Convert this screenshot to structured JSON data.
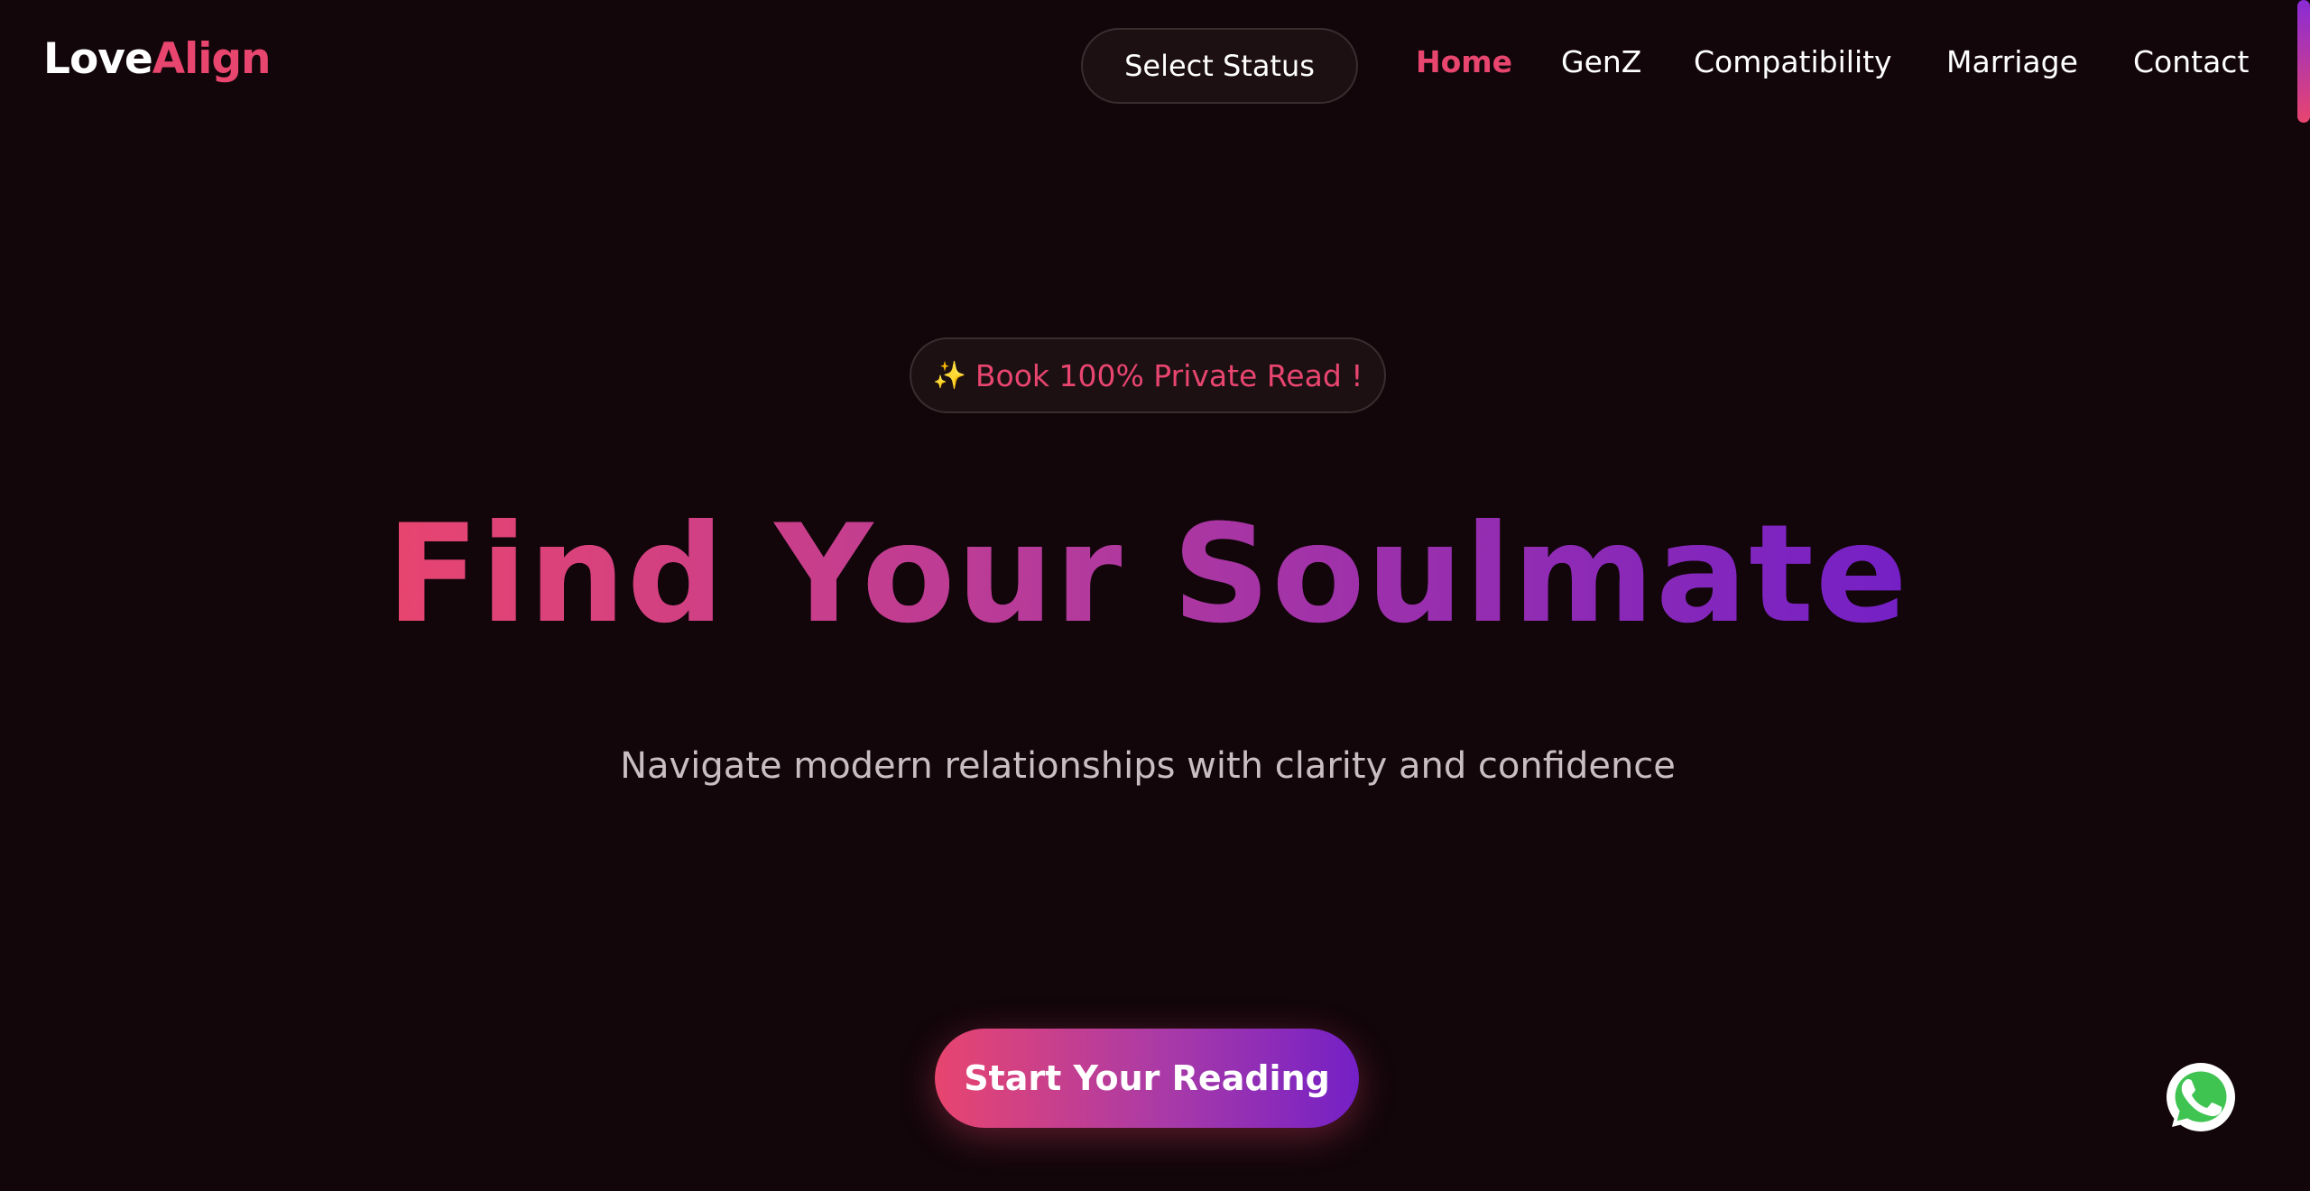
{
  "brand": {
    "part1": "Love",
    "part2": "Align"
  },
  "nav": {
    "status_select": "Select Status",
    "links": [
      {
        "label": "Home",
        "active": true
      },
      {
        "label": "GenZ",
        "active": false
      },
      {
        "label": "Compatibility",
        "active": false
      },
      {
        "label": "Marriage",
        "active": false
      },
      {
        "label": "Contact",
        "active": false
      }
    ]
  },
  "hero": {
    "badge_icon": "sparkles-icon",
    "badge_text": "Book 100% Private Read !",
    "title": "Find Your Soulmate",
    "subtitle": "Navigate modern relationships with clarity and confidence",
    "cta_label": "Start Your Reading"
  },
  "floating": {
    "chat_icon": "whatsapp-icon"
  },
  "colors": {
    "background": "#12060a",
    "accent_pink": "#e8456f",
    "accent_purple": "#7420c6",
    "muted_text": "#c9bec2"
  }
}
